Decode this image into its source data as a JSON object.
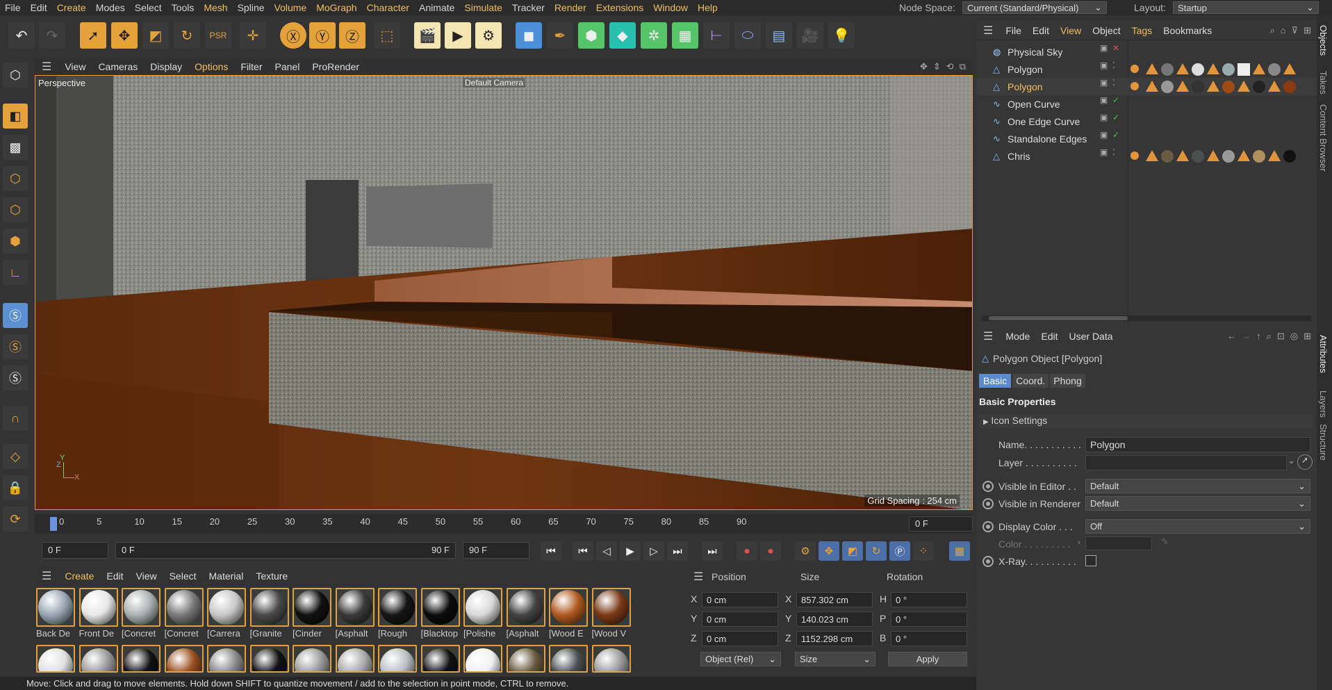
{
  "menubar": {
    "items": [
      "File",
      "Edit",
      "Create",
      "Modes",
      "Select",
      "Tools",
      "Mesh",
      "Spline",
      "Volume",
      "MoGraph",
      "Character",
      "Animate",
      "Simulate",
      "Tracker",
      "Render",
      "Extensions",
      "Window",
      "Help"
    ],
    "node_space_label": "Node Space:",
    "node_space_value": "Current (Standard/Physical)",
    "layout_label": "Layout:",
    "layout_value": "Startup"
  },
  "viewport": {
    "menu": [
      "View",
      "Cameras",
      "Display",
      "Options",
      "Filter",
      "Panel",
      "ProRender"
    ],
    "name": "Perspective",
    "camera": "Default Camera",
    "grid_spacing": "Grid Spacing : 254 cm",
    "axis_y": "Y",
    "axis_z": "Z",
    "axis_x": "X"
  },
  "timeline": {
    "ticks": [
      "0",
      "5",
      "10",
      "15",
      "20",
      "25",
      "30",
      "35",
      "40",
      "45",
      "50",
      "55",
      "60",
      "65",
      "70",
      "75",
      "80",
      "85",
      "90"
    ],
    "current_frame": "0 F",
    "start_field": "0 F",
    "range_start": "0 F",
    "range_end": "90 F",
    "end_field": "90 F"
  },
  "materials": {
    "menu": [
      "Create",
      "Edit",
      "View",
      "Select",
      "Material",
      "Texture"
    ],
    "row1": [
      {
        "name": "Back De",
        "color": "#9aa6b2"
      },
      {
        "name": "Front De",
        "color": "#e8e8e8"
      },
      {
        "name": "[Concret",
        "color": "#aab0b0"
      },
      {
        "name": "[Concret",
        "color": "#7a7a7a"
      },
      {
        "name": "[Carrera",
        "color": "#c8c8c8"
      },
      {
        "name": "[Granite",
        "color": "#4a4a4a"
      },
      {
        "name": "[Cinder",
        "color": "#111111"
      },
      {
        "name": "[Asphalt",
        "color": "#3a3a3a"
      },
      {
        "name": "[Rough",
        "color": "#151515"
      },
      {
        "name": "[Blacktop",
        "color": "#0c0c0c"
      },
      {
        "name": "[Polishe",
        "color": "#d8d8d8"
      },
      {
        "name": "[Asphalt",
        "color": "#444444"
      },
      {
        "name": "[Wood E",
        "color": "#b05a20"
      },
      {
        "name": "[Wood V",
        "color": "#7a3a15"
      }
    ],
    "row2_colors": [
      "#e0e0e0",
      "#999999",
      "#111111",
      "#9a5020",
      "#8a8a8a",
      "#111111",
      "#9a9a9a",
      "#aaaaaa",
      "#b8c0c0",
      "#111111",
      "#f0f0f0",
      "#6a5a40",
      "#4a5050",
      "#9a9a9a"
    ]
  },
  "coords": {
    "headers": [
      "Position",
      "Size",
      "Rotation"
    ],
    "rows": [
      {
        "axis": "X",
        "pos": "0 cm",
        "size_axis": "X",
        "size": "857.302 cm",
        "rot_axis": "H",
        "rot": "0 °"
      },
      {
        "axis": "Y",
        "pos": "0 cm",
        "size_axis": "Y",
        "size": "140.023 cm",
        "rot_axis": "P",
        "rot": "0 °"
      },
      {
        "axis": "Z",
        "pos": "0 cm",
        "size_axis": "Z",
        "size": "1152.298 cm",
        "rot_axis": "B",
        "rot": "0 °"
      }
    ],
    "mode": "Object (Rel)",
    "size_mode": "Size",
    "apply": "Apply"
  },
  "statusbar": "Move: Click and drag to move elements. Hold down SHIFT to quantize movement / add to the selection in point mode, CTRL to remove.",
  "objects": {
    "menu": [
      "File",
      "Edit",
      "View",
      "Object",
      "Tags",
      "Bookmarks"
    ],
    "items": [
      {
        "name": "Physical Sky",
        "selected": false
      },
      {
        "name": "Polygon",
        "selected": false
      },
      {
        "name": "Polygon",
        "selected": true
      },
      {
        "name": "Open Curve",
        "selected": false
      },
      {
        "name": "One Edge Curve",
        "selected": false
      },
      {
        "name": "Standalone Edges",
        "selected": false
      },
      {
        "name": "Chris",
        "selected": false
      }
    ]
  },
  "attributes": {
    "menu": [
      "Mode",
      "Edit",
      "User Data"
    ],
    "object_title": "Polygon Object [Polygon]",
    "tabs": [
      "Basic",
      "Coord.",
      "Phong"
    ],
    "section": "Basic Properties",
    "icon_settings": "Icon Settings",
    "name_label": "Name. . . . . . . . . . .",
    "name_value": "Polygon",
    "layer_label": "Layer . . . . . . . . . .",
    "vis_editor_label": "Visible in Editor . .",
    "vis_editor_value": "Default",
    "vis_renderer_label": "Visible in Renderer",
    "vis_renderer_value": "Default",
    "display_color_label": "Display Color . . .",
    "display_color_value": "Off",
    "color_label": "Color . . . . . . . . .",
    "xray_label": "X-Ray. . . . . . . . . ."
  },
  "sidetabs": [
    "Objects",
    "Takes",
    "Content Browser",
    "Attributes",
    "Layers",
    "Structure"
  ]
}
